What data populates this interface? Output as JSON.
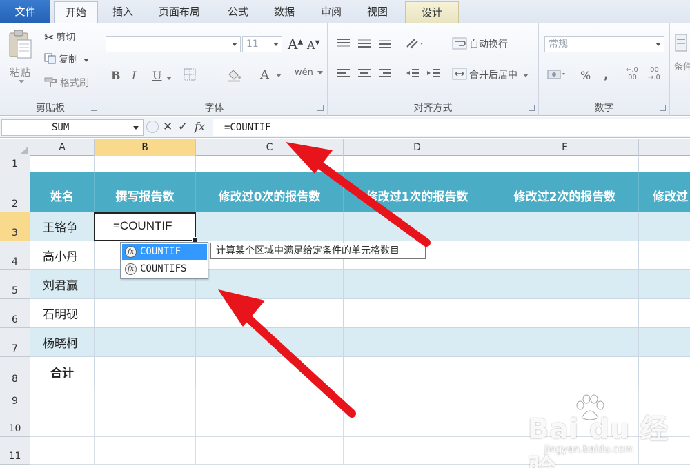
{
  "tabs": [
    {
      "label": "文件"
    },
    {
      "label": "开始"
    },
    {
      "label": "插入"
    },
    {
      "label": "页面布局"
    },
    {
      "label": "公式"
    },
    {
      "label": "数据"
    },
    {
      "label": "审阅"
    },
    {
      "label": "视图"
    },
    {
      "label": "设计"
    }
  ],
  "ribbon": {
    "clipboard": {
      "label": "剪贴板",
      "paste": "粘贴",
      "cut": "剪切",
      "copy": "复制",
      "format_painter": "格式刷"
    },
    "font": {
      "label": "字体",
      "font_name": "",
      "font_size": "11",
      "bold": "B",
      "italic": "I",
      "underline": "U",
      "grow": "A",
      "shrink": "A",
      "font_color": "A",
      "phonetic": "wén"
    },
    "alignment": {
      "label": "对齐方式",
      "wrap_text": "自动换行",
      "merge_center": "合并后居中"
    },
    "number": {
      "label": "数字",
      "format": "常规",
      "percent": "%",
      "comma": ",",
      "inc_decimal_top": "←.0",
      "inc_decimal_bottom": ".00",
      "dec_decimal_top": ".00",
      "dec_decimal_bottom": "→.0"
    },
    "styles": {
      "conditional_partial": "条件"
    }
  },
  "formula_bar": {
    "name_box": "SUM",
    "fx": "fx",
    "formula": "=COUNTIF"
  },
  "columns": [
    "A",
    "B",
    "C",
    "D",
    "E"
  ],
  "rows": [
    "1",
    "2",
    "3",
    "4",
    "5",
    "6",
    "7",
    "8",
    "9",
    "10",
    "11"
  ],
  "table": {
    "headers": [
      "姓名",
      "撰写报告数",
      "修改过0次的报告数",
      "修改过1次的报告数",
      "修改过2次的报告数",
      "修改过"
    ],
    "names": [
      "王铬争",
      "高小丹",
      "刘君赢",
      "石明砚",
      "杨晓柯"
    ],
    "total": "合计"
  },
  "active_cell": {
    "ref": "B3",
    "value": "=COUNTIF"
  },
  "autocomplete": {
    "items": [
      "COUNTIF",
      "COUNTIFS"
    ],
    "selected": 0,
    "fx_glyph": "fx"
  },
  "tooltip": "计算某个区域中满足给定条件的单元格数目",
  "watermark": {
    "logo": "Bai du 经验",
    "sub": "jingyan.baidu.com"
  },
  "colors": {
    "header_fill": "#4aacc5",
    "band_fill": "#d9ecf4",
    "selected_heading": "#f9d98c",
    "annotation_arrow": "#e8141b",
    "autocomplete_highlight": "#3399ff"
  }
}
